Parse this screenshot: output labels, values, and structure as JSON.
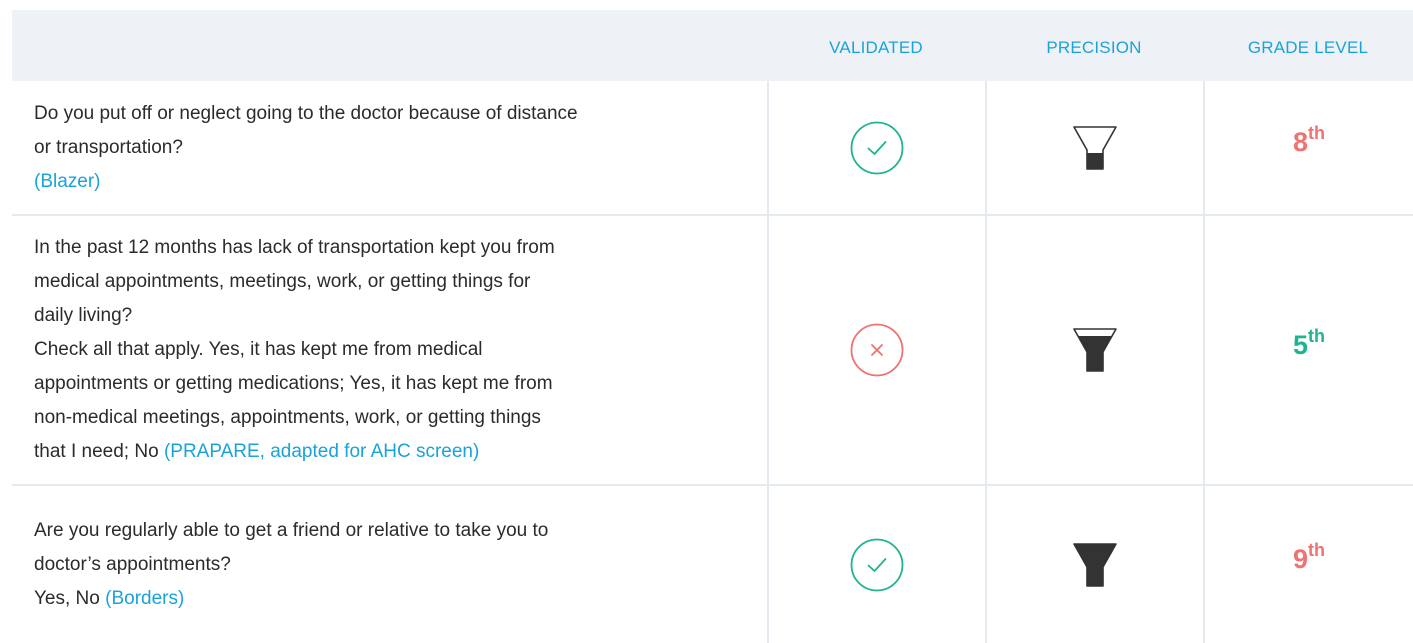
{
  "header": {
    "validated": "VALIDATED",
    "precision": "PRECISION",
    "grade_level": "GRADE LEVEL"
  },
  "colors": {
    "accent": "#1aa3d9",
    "validated_yes": "#1fb48f",
    "validated_no": "#f07272",
    "funnel": "#333333"
  },
  "rows": [
    {
      "question_lines": [
        "Do you put off or neglect going to the doctor because of distance",
        "or transportation?"
      ],
      "answers": "",
      "source": "(Blazer)",
      "validated": true,
      "validated_icon": "check-circle-icon",
      "precision_level": "low",
      "grade_number": "8",
      "grade_suffix": "th",
      "grade_color": "#f07272"
    },
    {
      "question_lines": [
        "In the past 12 months has lack of transportation kept you from",
        "medical appointments, meetings, work, or getting things for",
        "daily living?",
        "Check all that apply. Yes, it has kept me from medical",
        "appointments or getting medications; Yes, it has kept me from",
        "non-medical meetings, appointments, work, or getting things"
      ],
      "answers": "that I need; No",
      "source": "(PRAPARE, adapted for AHC screen)",
      "validated": false,
      "validated_icon": "x-circle-icon",
      "precision_level": "medium",
      "grade_number": "5",
      "grade_suffix": "th",
      "grade_color": "#1fb48f"
    },
    {
      "question_lines": [
        "Are you regularly able to get a friend or relative to take you to",
        "doctor’s appointments?"
      ],
      "answers": "Yes, No",
      "source": "(Borders)",
      "validated": true,
      "validated_icon": "check-circle-icon",
      "precision_level": "high",
      "grade_number": "9",
      "grade_suffix": "th",
      "grade_color": "#f07272"
    }
  ]
}
